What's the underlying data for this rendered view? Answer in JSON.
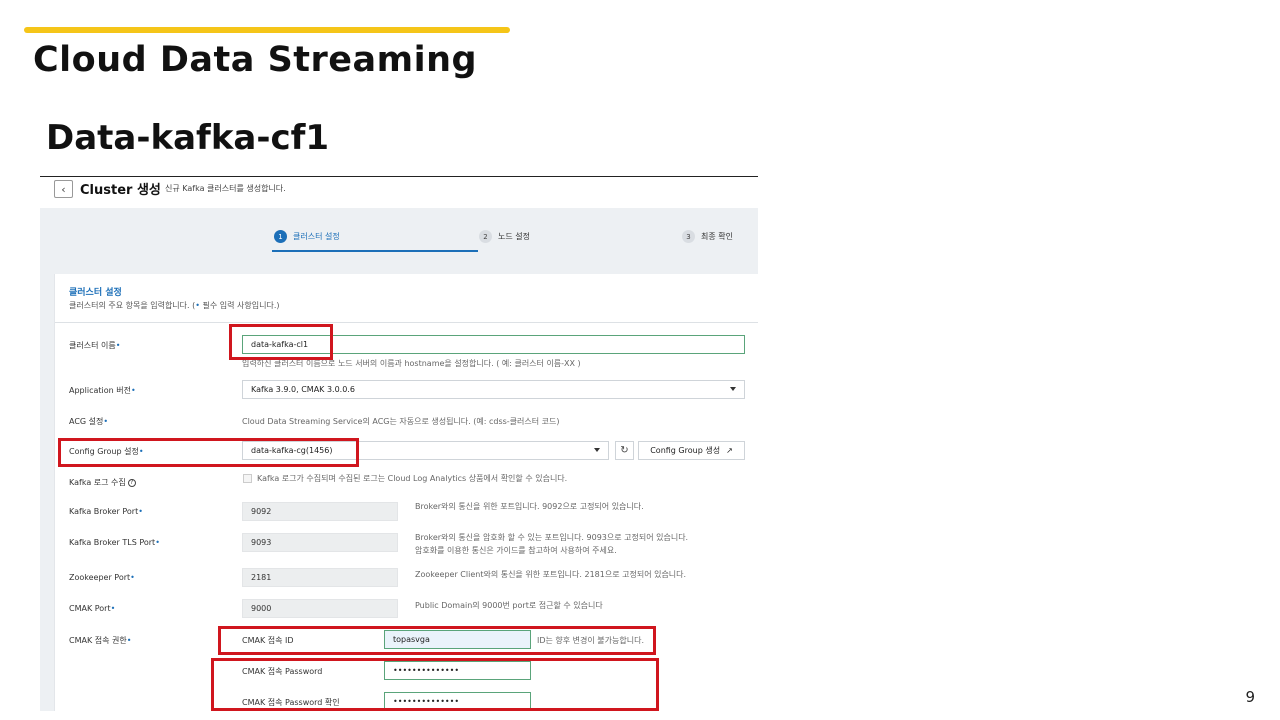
{
  "slide": {
    "title": "Cloud Data Streaming",
    "subtitle": "Data-kafka-cf1",
    "page_number": "9",
    "accent_color": "#f5c518"
  },
  "header": {
    "back_icon": "chevron-left-icon",
    "title": "Cluster 생성",
    "description": "신규 Kafka 클러스터를 생성합니다."
  },
  "stepper": [
    {
      "num": "1",
      "label": "클러스터 설정",
      "active": true
    },
    {
      "num": "2",
      "label": "노드 설정",
      "active": false
    },
    {
      "num": "3",
      "label": "최종 확인",
      "active": false
    }
  ],
  "panel": {
    "title": "클러스터 설정",
    "desc_prefix": "클러스터의 주요 항목을 입력합니다. (",
    "desc_suffix": " 필수 입력 사항입니다.)"
  },
  "form": {
    "cluster_name": {
      "label": "클러스터 이름",
      "value": "data-kafka-cl1",
      "hint": "입력하신 클러스터 이름으로 노드 서버의 이름과 hostname을 설정합니다. ( 예: 클러스터 이름-XX )"
    },
    "app_version": {
      "label": "Application 버전",
      "value": "Kafka 3.9.0, CMAK 3.0.0.6"
    },
    "acg": {
      "label": "ACG 설정",
      "hint": "Cloud Data Streaming Service의 ACG는 자동으로 생성됩니다. (예: cdss-클러스터 코드)"
    },
    "config_group": {
      "label": "Config Group 설정",
      "value": "data-kafka-cg(1456)",
      "create_button": "Config Group 생성"
    },
    "kafka_log": {
      "label": "Kafka 로그 수집",
      "hint": "Kafka 로그가 수집되며 수집된 로그는 Cloud Log Analytics 상품에서 확인할 수 있습니다."
    },
    "broker_port": {
      "label": "Kafka Broker Port",
      "value": "9092",
      "hint": "Broker와의 통신을 위한 포트입니다. 9092으로 고정되어 있습니다."
    },
    "broker_tls_port": {
      "label": "Kafka Broker TLS Port",
      "value": "9093",
      "hint1": "Broker와의 통신을 암호화 할 수 있는 포트입니다. 9093으로 고정되어 있습니다.",
      "hint2": "암호화를 이용한 통신은 가이드를 참고하여 사용하여 주세요."
    },
    "zookeeper_port": {
      "label": "Zookeeper Port",
      "value": "2181",
      "hint": "Zookeeper Client와의 통신을 위한 포트입니다. 2181으로 고정되어 있습니다."
    },
    "cmak_port": {
      "label": "CMAK Port",
      "value": "9000",
      "hint": "Public Domain의 9000번 port로 접근할 수 있습니다"
    },
    "cmak_auth": {
      "label": "CMAK 접속 권한",
      "id_label": "CMAK 접속 ID",
      "id_value": "topasvga",
      "id_hint": "ID는 향후 변경이 불가능합니다.",
      "pw_label": "CMAK 접속 Password",
      "pw_value": "••••••••••••••",
      "pw_confirm_label": "CMAK 접속 Password 확인",
      "pw_confirm_value": "••••••••••••••"
    }
  },
  "required_mark": "•",
  "help_mark": "?",
  "colors": {
    "primary": "#1c6fb8",
    "highlight": "#d0161e",
    "valid": "#5aa47a"
  }
}
